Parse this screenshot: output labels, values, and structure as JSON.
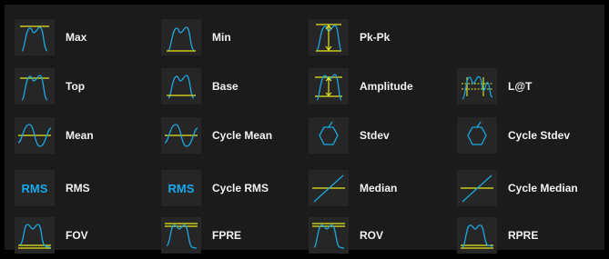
{
  "measurements": {
    "max": "Max",
    "min": "Min",
    "pkpk": "Pk-Pk",
    "top": "Top",
    "base": "Base",
    "amplitude": "Amplitude",
    "lat": "L@T",
    "mean": "Mean",
    "cycle_mean": "Cycle Mean",
    "stdev": "Stdev",
    "cycle_stdev": "Cycle Stdev",
    "rms": "RMS",
    "cycle_rms": "Cycle RMS",
    "median": "Median",
    "cycle_median": "Cycle Median",
    "fov": "FOV",
    "fpre": "FPRE",
    "rov": "ROV",
    "rpre": "RPRE"
  },
  "icons": {
    "rms_text": "RMS",
    "cycle_rms_text": "RMS"
  },
  "colors": {
    "trace": "#1aa8e0",
    "marker": "#e6e61e",
    "rms_text": "#18a8ee"
  }
}
